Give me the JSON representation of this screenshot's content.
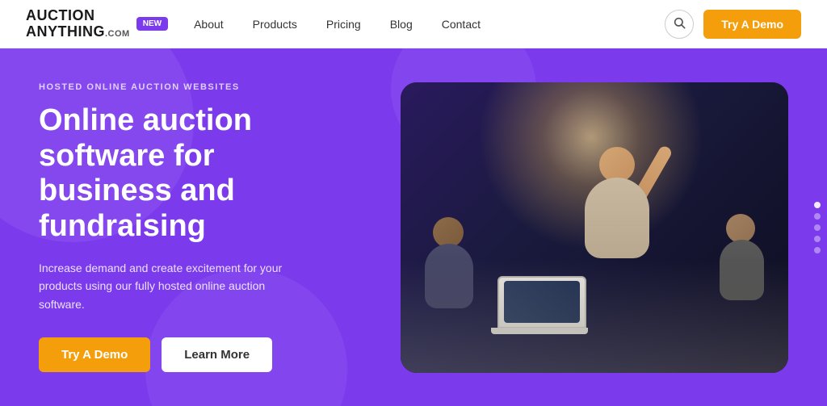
{
  "header": {
    "logo": {
      "line1": "AUCTION",
      "line2": "ANYTHING",
      "dotcom": ".COM",
      "badge_label": "NEW"
    },
    "nav": {
      "items": [
        {
          "id": "about",
          "label": "About"
        },
        {
          "id": "products",
          "label": "Products"
        },
        {
          "id": "pricing",
          "label": "Pricing"
        },
        {
          "id": "blog",
          "label": "Blog"
        },
        {
          "id": "contact",
          "label": "Contact"
        }
      ]
    },
    "cta_label": "Try A Demo",
    "search_icon": "🔍"
  },
  "hero": {
    "eyebrow": "HOSTED ONLINE AUCTION WEBSITES",
    "headline": "Online auction software for business and fundraising",
    "subtext": "Increase demand and create excitement for your products using our fully hosted online auction software.",
    "btn_try_demo": "Try A Demo",
    "btn_learn_more": "Learn More",
    "colors": {
      "bg": "#7c3aed",
      "cta_orange": "#f59e0b"
    }
  },
  "side_nav": {
    "dots": [
      "dot1",
      "dot2",
      "dot3",
      "dot4",
      "dot5"
    ],
    "active_index": 0
  }
}
